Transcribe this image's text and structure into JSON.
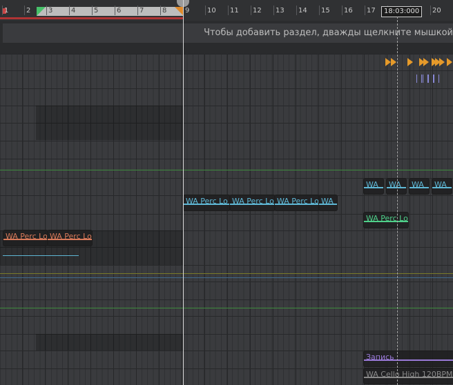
{
  "ruler": {
    "bars": [
      "1",
      "2",
      "3",
      "4",
      "5",
      "6",
      "7",
      "8",
      "9",
      "10",
      "11",
      "12",
      "13",
      "14",
      "15",
      "16",
      "17",
      "18",
      "19",
      "20"
    ],
    "time_readout": "18:03:000"
  },
  "arrangement": {
    "hint": "Чтобы добавить раздел, дважды щелкните мышкой"
  },
  "clips": {
    "perc_lo_1": "WA Perc Lo",
    "perc_lo_2": "WA Perc Lo",
    "perc_lo_3": "WA Perc Lo",
    "perc_lo_4": "WA",
    "perc_lo_5": "WA Perc Lo",
    "perc_lo_6": "WA Perc Lo",
    "perc_lo_7": "WA Perc Lo",
    "wa_a": "WA",
    "wa_b": "WA",
    "wa_c": "WA",
    "wa_d": "WA",
    "perc_lo_green": "WA Perc Lo",
    "record": "Запись",
    "cello": "WA Cello High 120BPM"
  },
  "colors": {
    "accent_cyan": "#5fb8d6",
    "accent_green": "#4fd08a",
    "accent_red": "#d87a5a",
    "accent_purple": "#9a7ad8",
    "marker_orange": "#e69a2a",
    "loop_green": "#47c26a",
    "loop_orange": "#e08a2a"
  }
}
